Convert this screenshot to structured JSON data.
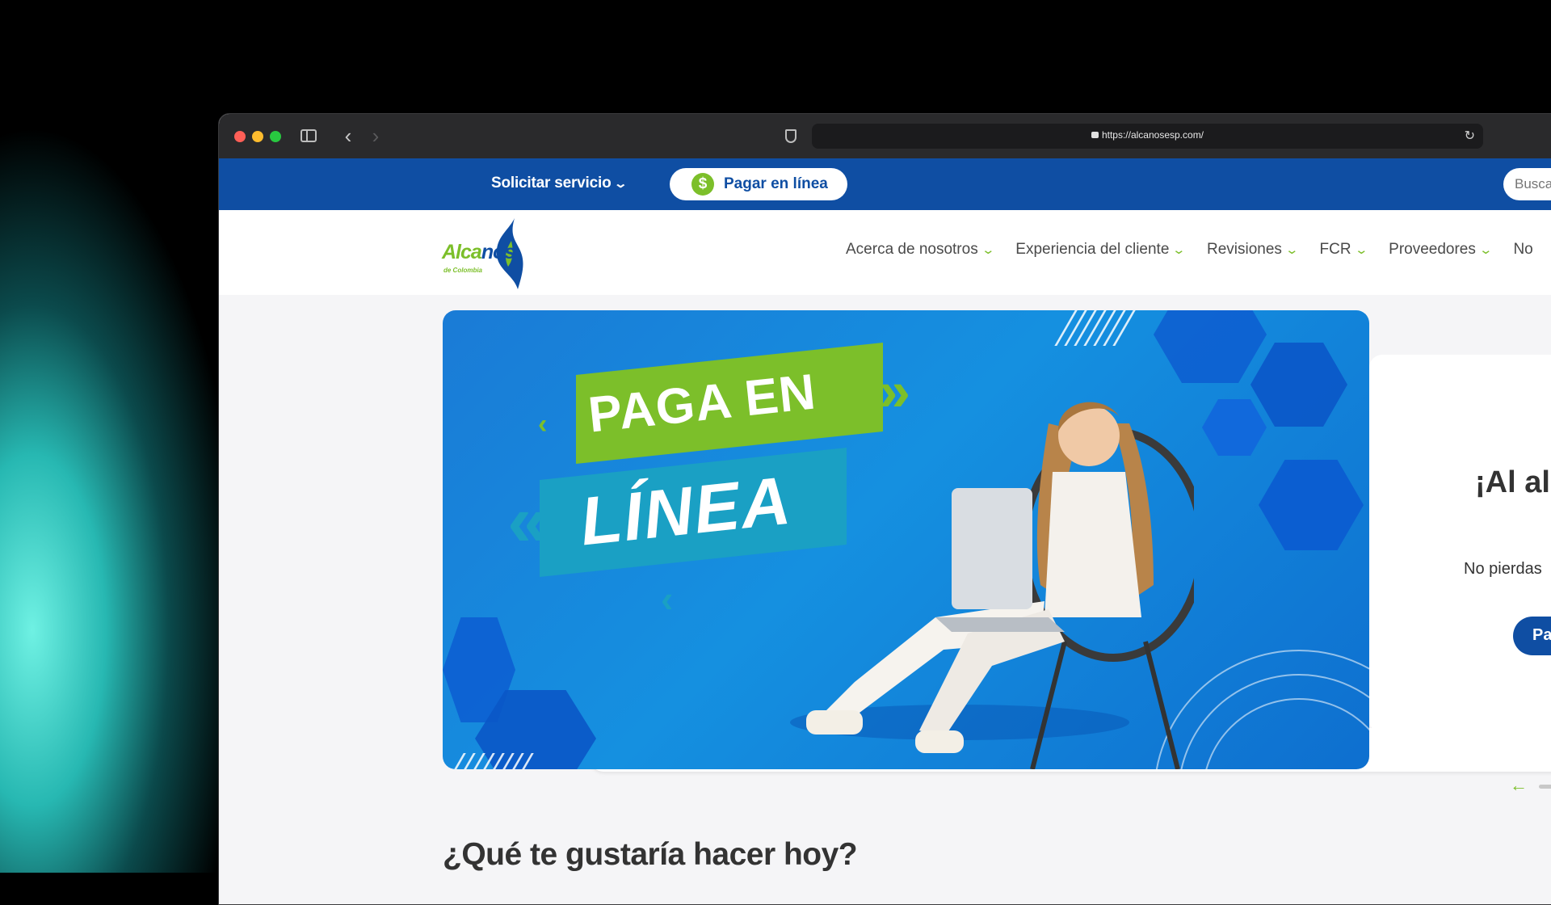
{
  "browser": {
    "url": "https://alcanosesp.com/"
  },
  "topbar": {
    "solicitar_label": "Solicitar servicio",
    "pagar_label": "Pagar en línea",
    "pagar_icon": "$",
    "search_placeholder": "Busca"
  },
  "logo": {
    "main_a": "Alca",
    "main_b": "nos",
    "sub": "de Colombia"
  },
  "nav": {
    "items": [
      {
        "label": "Acerca de nosotros"
      },
      {
        "label": "Experiencia del cliente"
      },
      {
        "label": "Revisiones"
      },
      {
        "label": "FCR"
      },
      {
        "label": "Proveedores"
      },
      {
        "label": "No"
      }
    ]
  },
  "hero": {
    "line1": "PAGA EN",
    "line2": "LÍNEA"
  },
  "card": {
    "title": "¡Al al",
    "text": "No pierdas",
    "button": "Pa"
  },
  "section": {
    "question": "¿Qué te gustaría hacer hoy?"
  },
  "colors": {
    "brand_blue": "#0f4ea3",
    "brand_green": "#7cbf2a"
  }
}
